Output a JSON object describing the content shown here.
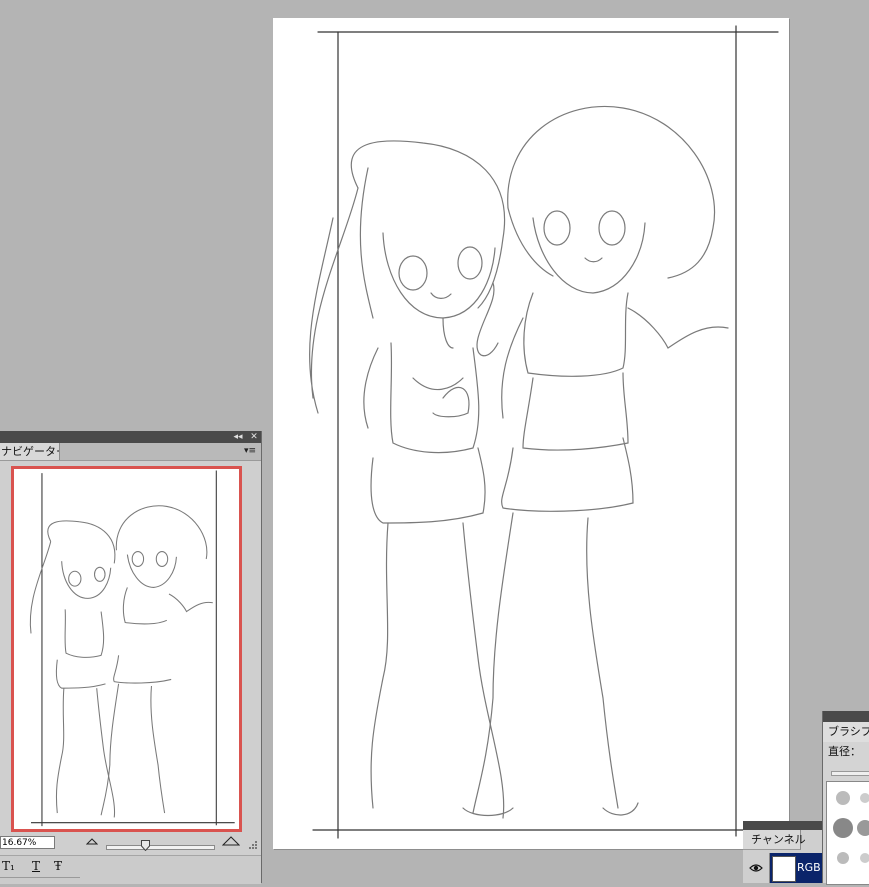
{
  "navigator": {
    "tab_label": "ナビゲーター",
    "zoom": "16.67%",
    "collapse_glyph": "◂◂",
    "close_glyph": "✕",
    "menu_glyph": "▾≡"
  },
  "type_tools": {
    "items": [
      "T₁",
      "T",
      "Ŧ"
    ]
  },
  "channels": {
    "tab_label": "チャンネル",
    "row_label": "RGB"
  },
  "brush": {
    "tab_label": "ブラシプ",
    "diameter_label": "直径："
  },
  "colors": {
    "workspace": "#b4b4b4",
    "panel": "#cfcfcf",
    "titlebar": "#4a4a4a",
    "view_box": "#d9534f",
    "selected_channel": "#0a246a"
  }
}
